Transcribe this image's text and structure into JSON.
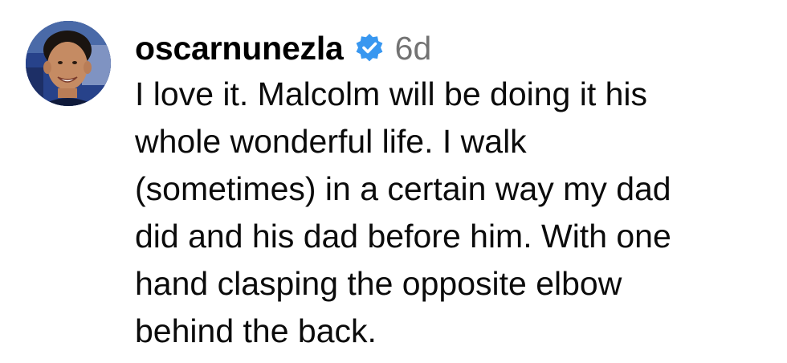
{
  "comment": {
    "username": "oscarnunezla",
    "timestamp": "6d",
    "verified_icon": "verified-badge-icon",
    "verified_color": "#3897f0",
    "avatar_icon": "profile-photo",
    "text_lines": [
      "I love it. Malcolm will be doing it his",
      "whole wonderful life. I walk",
      "(sometimes) in a certain way my dad",
      "did and his dad before him. With one",
      "hand clasping the opposite elbow",
      "behind the back."
    ]
  }
}
